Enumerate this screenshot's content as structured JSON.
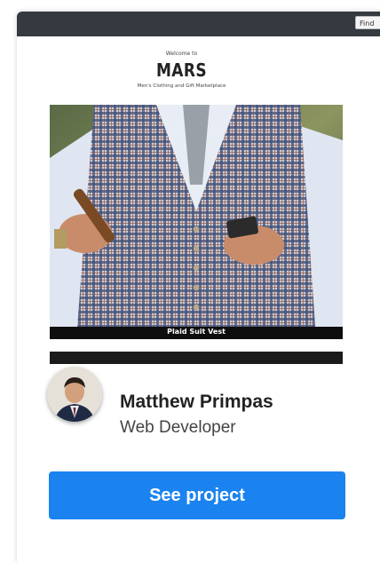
{
  "preview": {
    "find_button_label": "Find",
    "welcome_text": "Welcome to",
    "brand_name": "MARS",
    "tagline": "Men's Clothing and Gift Marketplace",
    "featured_caption": "Plaid Suit Vest"
  },
  "author": {
    "name": "Matthew Primpas",
    "role": "Web Developer"
  },
  "actions": {
    "see_project_label": "See project"
  },
  "colors": {
    "topbar": "#343a40",
    "button": "#1a83f0"
  }
}
